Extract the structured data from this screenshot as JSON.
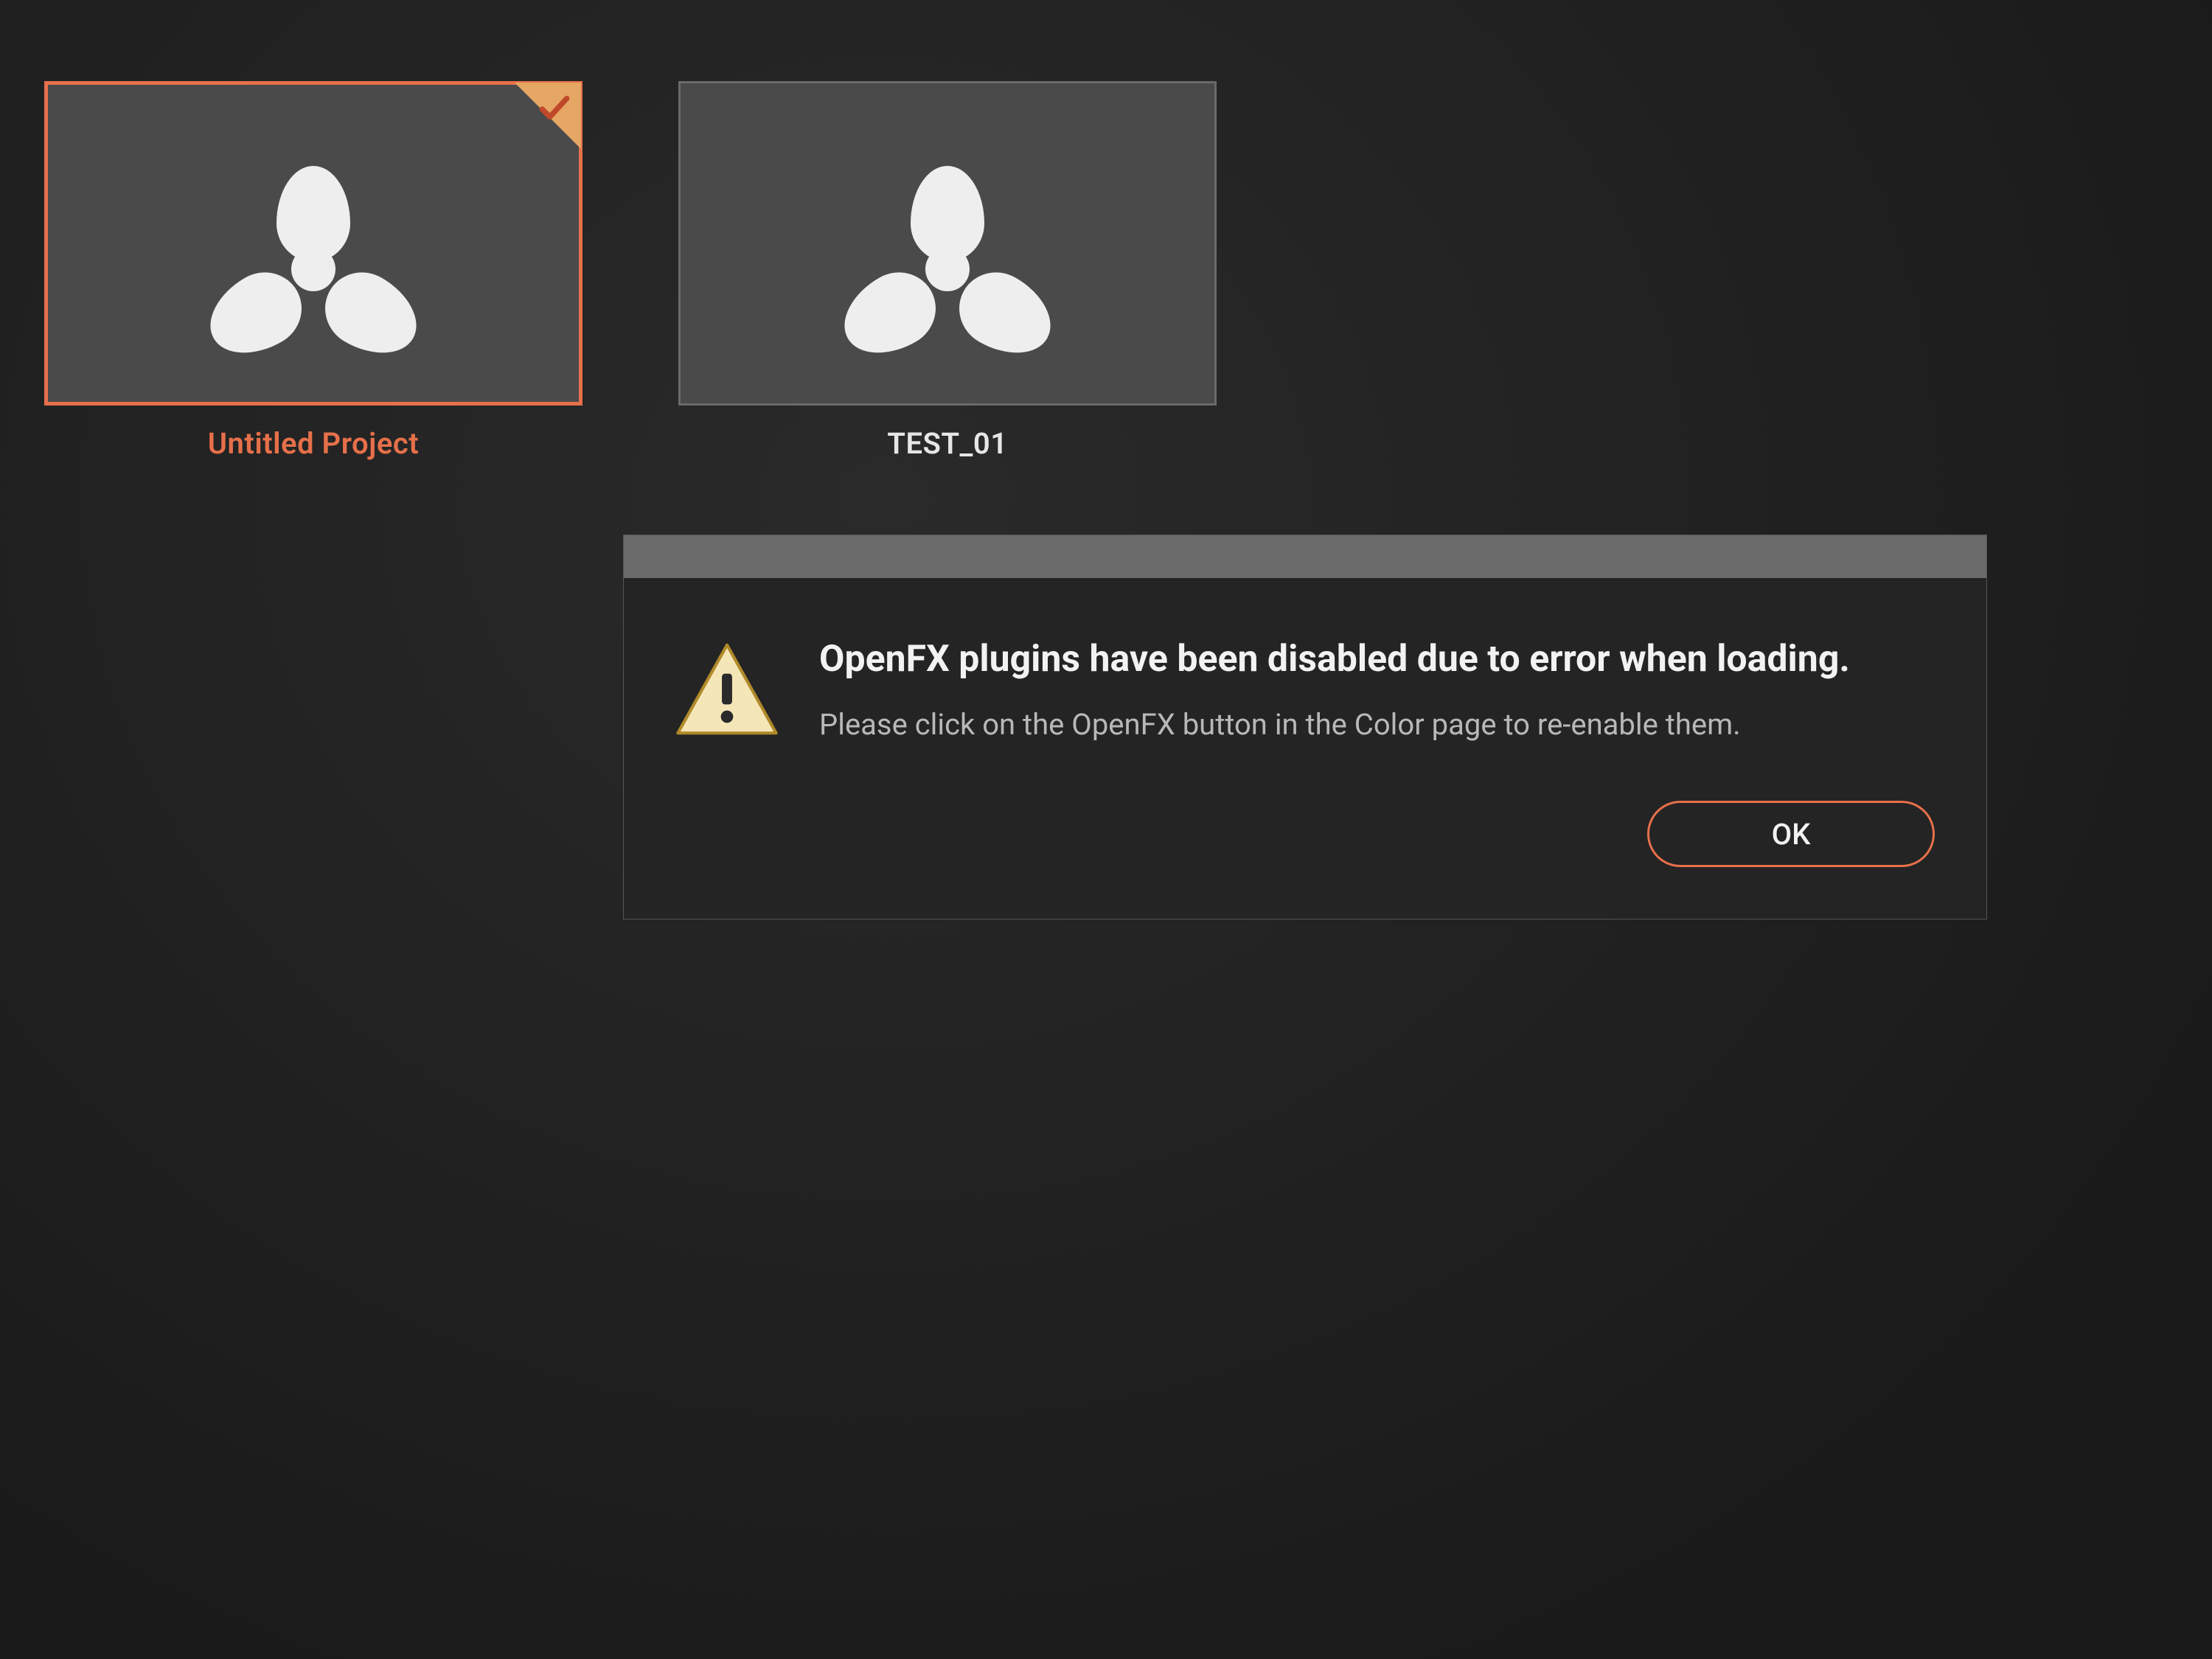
{
  "projects": [
    {
      "label": "Untitled Project",
      "selected": true
    },
    {
      "label": "TEST_01",
      "selected": false
    }
  ],
  "dialog": {
    "heading": "OpenFX plugins have been disabled due to error when loading.",
    "description": "Please click on the OpenFX button in the Color page to re-enable them.",
    "ok_label": "OK"
  },
  "colors": {
    "accent": "#e6704a",
    "background": "#1f1f1f",
    "dialog_bg": "#242424",
    "titlebar": "#6b6b6b"
  }
}
